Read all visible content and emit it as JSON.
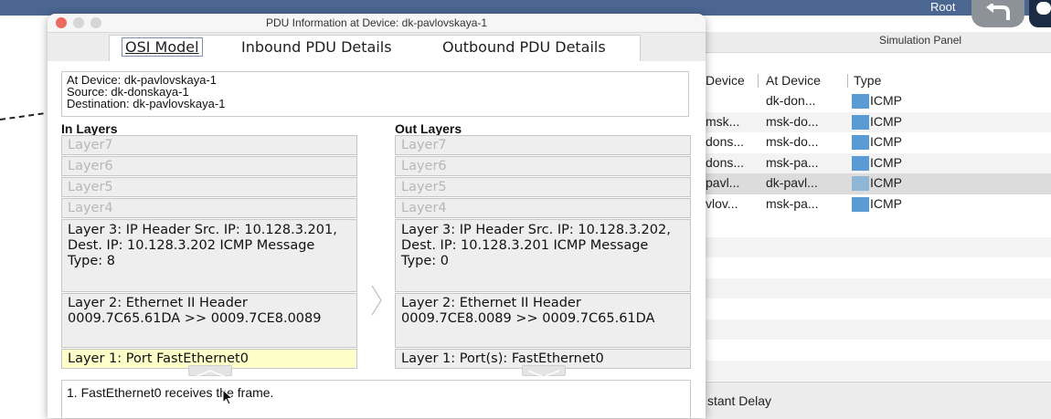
{
  "app": {
    "root_label": "Root",
    "simulation_panel": {
      "title": "Simulation Panel",
      "columns": [
        "Device",
        "At Device",
        "Type"
      ],
      "rows": [
        {
          "last_device": "",
          "at_device": "dk-don...",
          "type": "ICMP"
        },
        {
          "last_device": "msk...",
          "at_device": "msk-do...",
          "type": "ICMP"
        },
        {
          "last_device": "dons...",
          "at_device": "msk-do...",
          "type": "ICMP"
        },
        {
          "last_device": "dons...",
          "at_device": "msk-pa...",
          "type": "ICMP"
        },
        {
          "last_device": "pavl...",
          "at_device": "dk-pavl...",
          "type": "ICMP",
          "selected": true
        },
        {
          "last_device": "vlov...",
          "at_device": "msk-pa...",
          "type": "ICMP"
        }
      ],
      "bottom_label": "stant Delay",
      "type_color": "#5b9bd5"
    }
  },
  "dialog": {
    "title": "PDU Information at Device: dk-pavlovskaya-1",
    "tabs": [
      "OSI Model",
      "Inbound PDU Details",
      "Outbound PDU Details"
    ],
    "selected_tab": "OSI Model",
    "info": {
      "at_device": "At Device: dk-pavlovskaya-1",
      "source": "Source: dk-donskaya-1",
      "destination": "Destination: dk-pavlovskaya-1"
    },
    "in_layers": {
      "title": "In Layers",
      "layer7": "Layer7",
      "layer6": "Layer6",
      "layer5": "Layer5",
      "layer4": "Layer4",
      "layer3": "Layer 3: IP Header Src. IP: 10.128.3.201, Dest. IP: 10.128.3.202 ICMP Message Type: 8",
      "layer2": "Layer 2: Ethernet II Header 0009.7C65.61DA >> 0009.7CE8.0089",
      "layer1": "Layer 1: Port FastEthernet0"
    },
    "out_layers": {
      "title": "Out Layers",
      "layer7": "Layer7",
      "layer6": "Layer6",
      "layer5": "Layer5",
      "layer4": "Layer4",
      "layer3": "Layer 3: IP Header Src. IP: 10.128.3.202, Dest. IP: 10.128.3.201 ICMP Message Type: 0",
      "layer2": "Layer 2: Ethernet II Header 0009.7CE8.0089 >> 0009.7C65.61DA",
      "layer1": "Layer 1: Port(s): FastEthernet0"
    },
    "description": "1. FastEthernet0 receives the frame.",
    "highlight_color": "#ffffc9"
  }
}
